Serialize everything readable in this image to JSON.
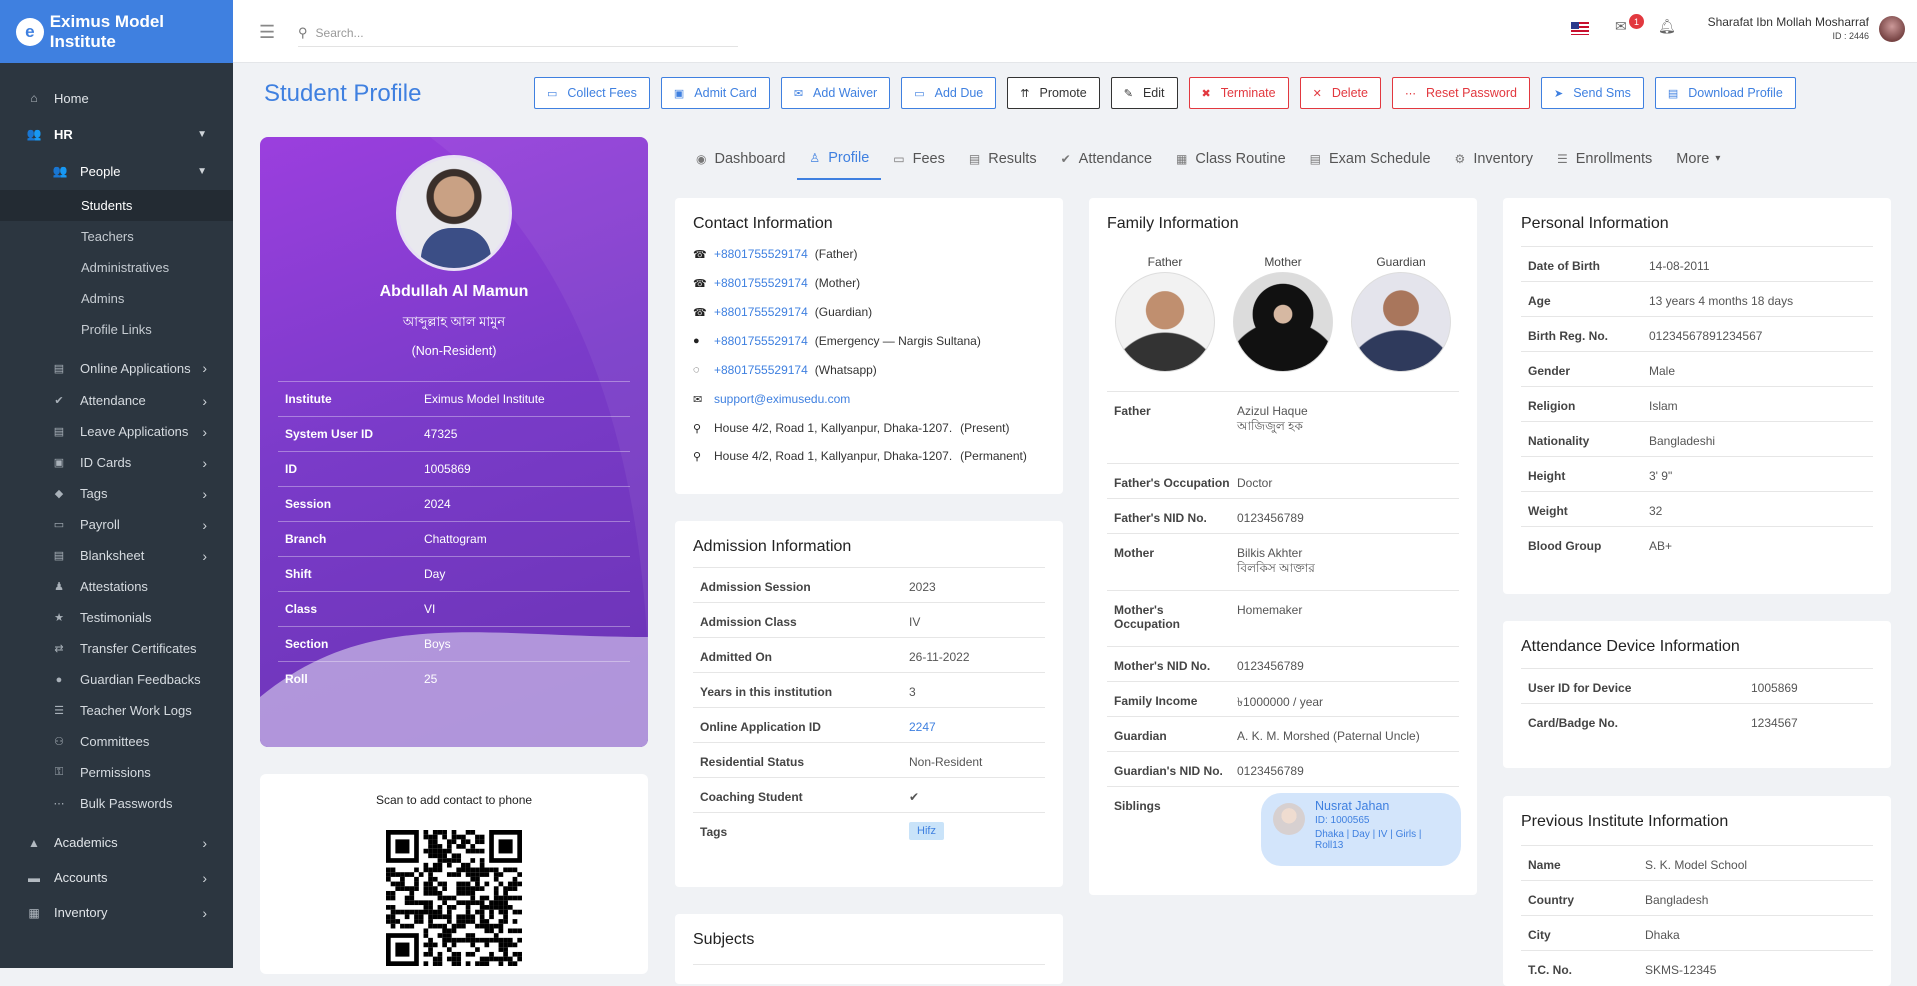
{
  "brand": {
    "name": "Eximus Model Institute"
  },
  "sidebar": {
    "home": "Home",
    "hr": "HR",
    "people": "People",
    "people_items": [
      "Students",
      "Teachers",
      "Administratives",
      "Admins",
      "Profile Links"
    ],
    "hr_items": [
      {
        "label": "Online Applications",
        "icon": "file-icon",
        "chev": true
      },
      {
        "label": "Attendance",
        "icon": "check-circle-icon",
        "chev": true
      },
      {
        "label": "Leave Applications",
        "icon": "file-icon",
        "chev": true
      },
      {
        "label": "ID Cards",
        "icon": "id-card-icon",
        "chev": true
      },
      {
        "label": "Tags",
        "icon": "tag-icon",
        "chev": true
      },
      {
        "label": "Payroll",
        "icon": "money-icon",
        "chev": true
      },
      {
        "label": "Blanksheet",
        "icon": "clipboard-icon",
        "chev": true
      },
      {
        "label": "Attestations",
        "icon": "stamp-icon",
        "chev": false
      },
      {
        "label": "Testimonials",
        "icon": "certificate-icon",
        "chev": false
      },
      {
        "label": "Transfer Certificates",
        "icon": "transfer-icon",
        "chev": false
      },
      {
        "label": "Guardian Feedbacks",
        "icon": "comment-icon",
        "chev": false
      },
      {
        "label": "Teacher Work Logs",
        "icon": "log-icon",
        "chev": false
      },
      {
        "label": "Committees",
        "icon": "users-icon",
        "chev": false
      },
      {
        "label": "Permissions",
        "icon": "user-lock-icon",
        "chev": false
      },
      {
        "label": "Bulk Passwords",
        "icon": "dots-icon",
        "chev": false
      }
    ],
    "bottom": [
      "Academics",
      "Accounts",
      "Inventory"
    ]
  },
  "topbar": {
    "search_placeholder": "Search...",
    "notif_count": "1",
    "user_name": "Sharafat Ibn Mollah Mosharraf",
    "user_id": "ID : 2446"
  },
  "page": {
    "title": "Student Profile"
  },
  "actions": [
    {
      "label": "Collect Fees",
      "style": "blue"
    },
    {
      "label": "Admit Card",
      "style": "blue"
    },
    {
      "label": "Add Waiver",
      "style": "blue"
    },
    {
      "label": "Add Due",
      "style": "blue"
    },
    {
      "label": "Promote",
      "style": "dark"
    },
    {
      "label": "Edit",
      "style": "dark"
    },
    {
      "label": "Terminate",
      "style": "red"
    },
    {
      "label": "Delete",
      "style": "red"
    },
    {
      "label": "Reset Password",
      "style": "red"
    },
    {
      "label": "Send Sms",
      "style": "blue"
    },
    {
      "label": "Download Profile",
      "style": "blue"
    }
  ],
  "profile": {
    "name": "Abdullah Al Mamun",
    "name_bn": "আব্দুল্লাহ আল মামুন",
    "residency": "(Non-Resident)",
    "rows": [
      [
        "Institute",
        "Eximus Model Institute"
      ],
      [
        "System User ID",
        "47325"
      ],
      [
        "ID",
        "1005869"
      ],
      [
        "Session",
        "2024"
      ],
      [
        "Branch",
        "Chattogram"
      ],
      [
        "Shift",
        "Day"
      ],
      [
        "Class",
        "VI"
      ],
      [
        "Section",
        "Boys"
      ],
      [
        "Roll",
        "25"
      ]
    ],
    "qr_caption": "Scan to add contact to phone"
  },
  "tabs": [
    "Dashboard",
    "Profile",
    "Fees",
    "Results",
    "Attendance",
    "Class Routine",
    "Exam Schedule",
    "Inventory",
    "Enrollments",
    "More"
  ],
  "contact": {
    "title": "Contact Information",
    "phones": [
      [
        "+8801755529174",
        "(Father)"
      ],
      [
        "+8801755529174",
        "(Mother)"
      ],
      [
        "+8801755529174",
        "(Guardian)"
      ],
      [
        "+8801755529174",
        "(Emergency — Nargis Sultana)"
      ],
      [
        "+8801755529174",
        "(Whatsapp)"
      ]
    ],
    "email": "support@eximusedu.com",
    "addresses": [
      [
        "House 4/2, Road 1, Kallyanpur, Dhaka-1207.",
        "(Present)"
      ],
      [
        "House 4/2, Road 1, Kallyanpur, Dhaka-1207.",
        "(Permanent)"
      ]
    ]
  },
  "admission": {
    "title": "Admission Information",
    "rows": [
      [
        "Admission Session",
        "2023"
      ],
      [
        "Admission Class",
        "IV"
      ],
      [
        "Admitted On",
        "26-11-2022"
      ],
      [
        "Years in this institution",
        "3"
      ],
      [
        "Online Application ID",
        "2247"
      ],
      [
        "Residential Status",
        "Non-Resident"
      ],
      [
        "Coaching Student",
        "✔"
      ],
      [
        "Tags",
        "Hifz"
      ]
    ]
  },
  "subjects": {
    "title": "Subjects"
  },
  "family": {
    "title": "Family Information",
    "heads": [
      "Father",
      "Mother",
      "Guardian"
    ],
    "rows": [
      [
        "Father",
        "Azizul Haque",
        "আজিজুল হক"
      ],
      [
        "Father's Occupation",
        "Doctor",
        ""
      ],
      [
        "Father's NID No.",
        "0123456789",
        ""
      ],
      [
        "Mother",
        "Bilkis Akhter",
        "বিলকিস আক্তার"
      ],
      [
        "Mother's Occupation",
        "Homemaker",
        ""
      ],
      [
        "Mother's NID No.",
        "0123456789",
        ""
      ],
      [
        "Family Income",
        "৳1000000 / year",
        ""
      ],
      [
        "Guardian",
        "A. K. M. Morshed (Paternal Uncle)",
        ""
      ],
      [
        "Guardian's NID No.",
        "0123456789",
        ""
      ]
    ],
    "siblings_label": "Siblings",
    "sibling": {
      "name": "Nusrat Jahan",
      "id": "ID: 1000565",
      "info": "Dhaka | Day | IV | Girls |",
      "roll": "Roll13"
    }
  },
  "personal": {
    "title": "Personal Information",
    "rows": [
      [
        "Date of Birth",
        "14-08-2011"
      ],
      [
        "Age",
        "13 years 4 months 18 days"
      ],
      [
        "Birth Reg. No.",
        "01234567891234567"
      ],
      [
        "Gender",
        "Male"
      ],
      [
        "Religion",
        "Islam"
      ],
      [
        "Nationality",
        "Bangladeshi"
      ],
      [
        "Height",
        "3' 9\""
      ],
      [
        "Weight",
        "32"
      ],
      [
        "Blood Group",
        "AB+"
      ]
    ]
  },
  "device": {
    "title": "Attendance Device Information",
    "rows": [
      [
        "User ID for Device",
        "1005869"
      ],
      [
        "Card/Badge No.",
        "1234567"
      ]
    ]
  },
  "previous": {
    "title": "Previous Institute Information",
    "rows": [
      [
        "Name",
        "S. K. Model School"
      ],
      [
        "Country",
        "Bangladesh"
      ],
      [
        "City",
        "Dhaka"
      ],
      [
        "T.C. No.",
        "SKMS-12345"
      ]
    ]
  }
}
